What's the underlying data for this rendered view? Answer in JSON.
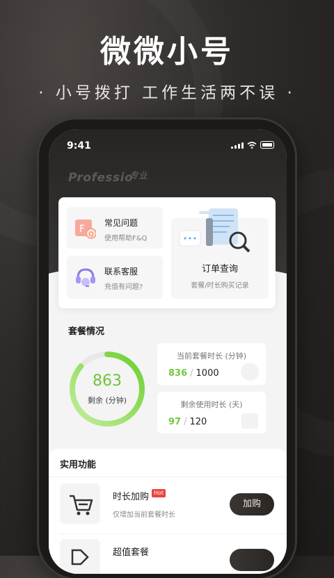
{
  "headline": "微微小号",
  "subline": "· 小号拨打 工作生活两不误 ·",
  "status_bar": {
    "time": "9:41"
  },
  "brand": {
    "en": "Professio",
    "cn": "专业"
  },
  "quick_actions": [
    {
      "title": "常见问题",
      "desc": "使用帮助F&Q",
      "icon": "faq-icon"
    },
    {
      "title": "联系客服",
      "desc": "充值有问题?",
      "icon": "headset-icon"
    }
  ],
  "order_query": {
    "title": "订单查询",
    "desc": "套餐/时长购买记录",
    "icon": "document-search-icon"
  },
  "plan": {
    "section_title": "套餐情况",
    "remaining_value": "863",
    "remaining_label": "剩余 (分钟)",
    "remaining_fraction": 0.863,
    "current_duration": {
      "label": "当前套餐时长 (分钟)",
      "used": "836",
      "sep": "/",
      "total": "1000"
    },
    "remaining_days": {
      "label": "剩余使用时长 (天)",
      "used": "97",
      "sep": "/",
      "total": "120"
    }
  },
  "utilities": {
    "section_title": "实用功能",
    "items": [
      {
        "title": "时长加购",
        "badge": "Hot",
        "desc": "仅增加当前套餐时长",
        "button": "加购",
        "icon": "cart-icon"
      },
      {
        "title": "超值套餐",
        "icon": "tag-icon"
      }
    ]
  },
  "colors": {
    "accent_green": "#72c93d",
    "dark_button": "#2e2a27"
  }
}
